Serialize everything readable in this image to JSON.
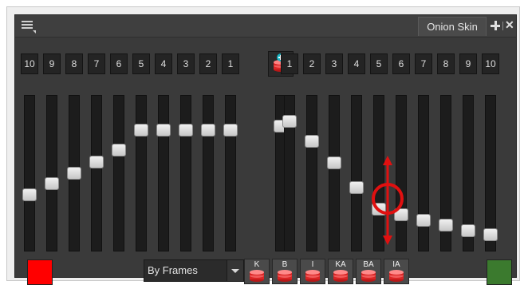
{
  "panel": {
    "tab_label": "Onion Skin",
    "menu_icon": "hamburger-menu-icon",
    "add_icon": "plus-icon",
    "close_icon": "close-icon"
  },
  "before_frames": {
    "labels": [
      "10",
      "9",
      "8",
      "7",
      "6",
      "5",
      "4",
      "3",
      "2",
      "1"
    ],
    "levels": [
      0.35,
      0.43,
      0.5,
      0.58,
      0.66,
      0.8,
      0.8,
      0.8,
      0.8,
      0.8
    ]
  },
  "center_level": 0.83,
  "after_frames": {
    "labels": [
      "1",
      "2",
      "3",
      "4",
      "5",
      "6",
      "7",
      "8",
      "9",
      "10"
    ],
    "levels": [
      0.86,
      0.72,
      0.57,
      0.4,
      0.25,
      0.21,
      0.17,
      0.14,
      0.1,
      0.07
    ]
  },
  "colors": {
    "before_swatch": "#ff0000",
    "after_swatch": "#3b7a2e",
    "annotation": "#e01010"
  },
  "mode_dropdown": {
    "value": "By Frames"
  },
  "type_buttons": [
    "K",
    "B",
    "I",
    "KA",
    "BA",
    "IA"
  ]
}
